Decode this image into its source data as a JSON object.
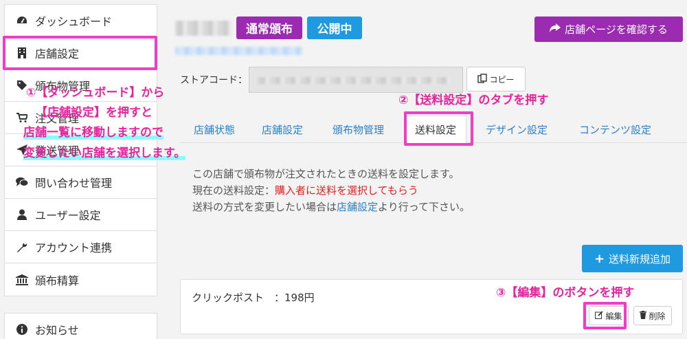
{
  "sidebar": {
    "items": [
      {
        "label": "ダッシュボード",
        "icon": "dashboard-icon"
      },
      {
        "label": "店舗設定",
        "icon": "building-icon"
      },
      {
        "label": "頒布物管理",
        "icon": "tag-icon"
      },
      {
        "label": "注文管理",
        "icon": "cart-icon"
      },
      {
        "label": "発送管理",
        "icon": "send-icon"
      },
      {
        "label": "問い合わせ管理",
        "icon": "comments-icon"
      },
      {
        "label": "ユーザー設定",
        "icon": "user-icon"
      },
      {
        "label": "アカウント連携",
        "icon": "wrench-icon"
      },
      {
        "label": "頒布精算",
        "icon": "bank-icon"
      }
    ],
    "news": {
      "label": "お知らせ",
      "icon": "info-icon"
    }
  },
  "store": {
    "badge_type": "通常頒布",
    "badge_status": "公開中",
    "confirm_button": "店舗ページを確認する",
    "code_label": "ストアコード：",
    "copy_button": "コピー"
  },
  "tabs": [
    "店舗状態",
    "店舗設定",
    "頒布物管理",
    "送料設定",
    "デザイン設定",
    "コンテンツ設定"
  ],
  "content": {
    "line1": "この店舗で頒布物が注文されたときの送料を設定します。",
    "line2_prefix": "現在の送料設定：",
    "line2_value": "購入者に送料を選択してもらう",
    "line3_prefix": "送料の方式を変更したい場合は",
    "line3_link": "店舗設定",
    "line3_suffix": "より行って下さい。",
    "add_button": "送料新規追加"
  },
  "shipping_item": {
    "name": "クリックポスト　：198円",
    "edit": "編集",
    "delete": "削除"
  },
  "annotations": {
    "a1_l1": "①【ダッシュボード】から",
    "a1_l2": "【店舗設定】を押すと",
    "a1_l3": "店舗一覧に移動しますので",
    "a1_l4": "変更したい店舗を選択します。",
    "a2": "②【送料設定】のタブを押す",
    "a3": "③【編集】のボタンを押す"
  },
  "colors": {
    "accent_purple": "#9b2bb0",
    "accent_blue": "#1f9ae0",
    "highlight": "#f03cc8",
    "link": "#2a7fc9",
    "alert_red": "#e0221e"
  }
}
